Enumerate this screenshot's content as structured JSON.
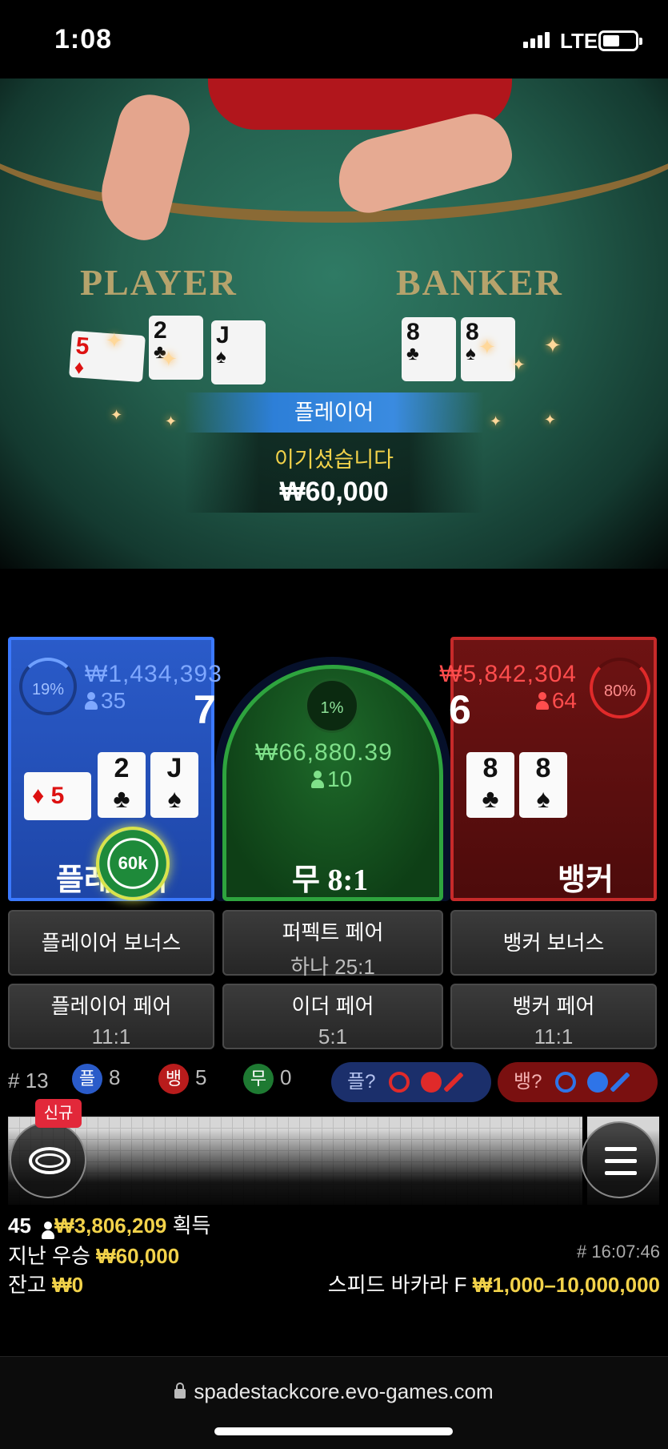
{
  "status": {
    "time": "1:08",
    "network": "LTE"
  },
  "video": {
    "felt_player": "PLAYER",
    "felt_banker": "BANKER",
    "player_cards": [
      {
        "rank": "5",
        "suit": "♦",
        "red": true
      },
      {
        "rank": "2",
        "suit": "♣",
        "red": false
      },
      {
        "rank": "J",
        "suit": "♠",
        "red": false
      }
    ],
    "banker_cards": [
      {
        "rank": "8",
        "suit": "♣",
        "red": false
      },
      {
        "rank": "8",
        "suit": "♠",
        "red": false
      }
    ],
    "result_label": "플레이어",
    "win_label": "이기셨습니다",
    "win_amount": "₩60,000"
  },
  "player_zone": {
    "percent": "19%",
    "stake": "₩1,434,393",
    "count": "35",
    "score": "7",
    "label": "플레이어",
    "chip": "60k",
    "cards": [
      {
        "rank": "5",
        "suit": "♦"
      },
      {
        "rank": "2",
        "suit": "♣"
      },
      {
        "rank": "J",
        "suit": "♠"
      }
    ]
  },
  "tie_zone": {
    "percent": "1%",
    "stake": "₩66,880.39",
    "count": "10",
    "label": "무 8:1"
  },
  "banker_zone": {
    "percent": "80%",
    "stake": "₩5,842,304",
    "count": "64",
    "score": "6",
    "label": "뱅커",
    "cards": [
      {
        "rank": "8",
        "suit": "♣"
      },
      {
        "rank": "8",
        "suit": "♠"
      }
    ]
  },
  "side_bets": {
    "player_bonus": "플레이어 보너스",
    "perfect_pair": "퍼펙트 페어",
    "perfect_pair_odds": "하나 25:1",
    "banker_bonus": "뱅커 보너스",
    "player_pair": "플레이어 페어",
    "player_pair_odds": "11:1",
    "either_pair": "이더 페어",
    "either_pair_odds": "5:1",
    "banker_pair": "뱅커 페어",
    "banker_pair_odds": "11:1"
  },
  "stats": {
    "round_label": "# 13",
    "player_badge": "플",
    "player_count": "8",
    "banker_badge": "뱅",
    "banker_count": "5",
    "tie_badge": "무",
    "tie_count": "0",
    "ask_player": "플?",
    "ask_banker": "뱅?"
  },
  "lobby": {
    "new_badge": "신규"
  },
  "footer": {
    "players": "45",
    "total_won": "₩3,806,209",
    "won_suffix": "획득",
    "last_win_label": "지난 우승",
    "last_win": "₩60,000",
    "balance_label": "잔고",
    "balance": "₩0",
    "time": "# 16:07:46",
    "table_name": "스피드 바카라 F",
    "limits": "₩1,000–10,000,000"
  },
  "browser": {
    "url": "spadestackcore.evo-games.com"
  },
  "colors": {
    "player": "#2a5bc9",
    "banker": "#6e1313",
    "tie": "#1e6a2a",
    "gold": "#f2d24a"
  }
}
